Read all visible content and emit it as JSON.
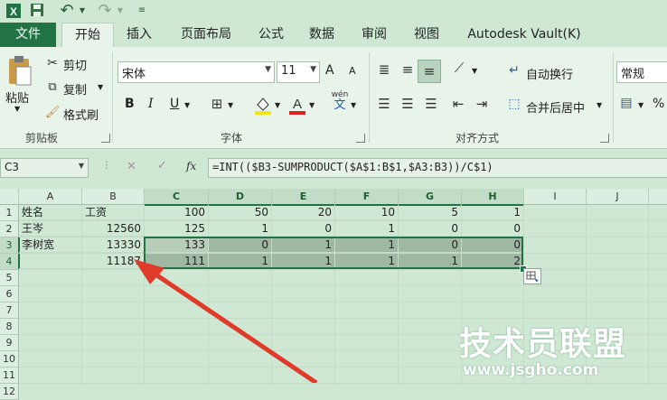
{
  "ribbon_tabs": [
    "文件",
    "开始",
    "插入",
    "页面布局",
    "公式",
    "数据",
    "审阅",
    "视图",
    "Autodesk Vault(K)"
  ],
  "clipboard": {
    "paste": "粘贴",
    "cut": "剪切",
    "copy": "复制",
    "format_painter": "格式刷",
    "group": "剪贴板"
  },
  "font": {
    "name": "宋体",
    "size": "11",
    "group": "字体",
    "bold": "B",
    "italic": "I",
    "underline": "U",
    "grow": "A",
    "shrink": "A",
    "phonetic_top": "wén",
    "phonetic_bottom": "文"
  },
  "alignment": {
    "wrap": "自动换行",
    "merge": "合并后居中",
    "group": "对齐方式"
  },
  "number": {
    "format": "常规",
    "percent": "%"
  },
  "namebox": "C3",
  "fx": "fx",
  "formula": "=INT(($B3-SUMPRODUCT($A$1:B$1,$A3:B3))/C$1)",
  "columns": [
    "A",
    "B",
    "C",
    "D",
    "E",
    "F",
    "G",
    "H",
    "I",
    "J"
  ],
  "rows": [
    "1",
    "2",
    "3",
    "4",
    "5",
    "6",
    "7",
    "8",
    "9",
    "10",
    "11",
    "12"
  ],
  "cells": {
    "r1": [
      "姓名",
      "工资",
      "100",
      "50",
      "20",
      "10",
      "5",
      "1"
    ],
    "r2": [
      "王岑",
      "12560",
      "125",
      "1",
      "0",
      "1",
      "0",
      "0"
    ],
    "r3": [
      "李树宽",
      "13330",
      "133",
      "0",
      "1",
      "1",
      "0",
      "0"
    ],
    "r4": [
      "",
      "11187",
      "111",
      "1",
      "1",
      "1",
      "1",
      "2"
    ]
  },
  "watermark": {
    "title": "技术员联盟",
    "url": "www.jsgho.com"
  },
  "colors": {
    "excel_green": "#217346",
    "arrow": "#e03a2a"
  }
}
